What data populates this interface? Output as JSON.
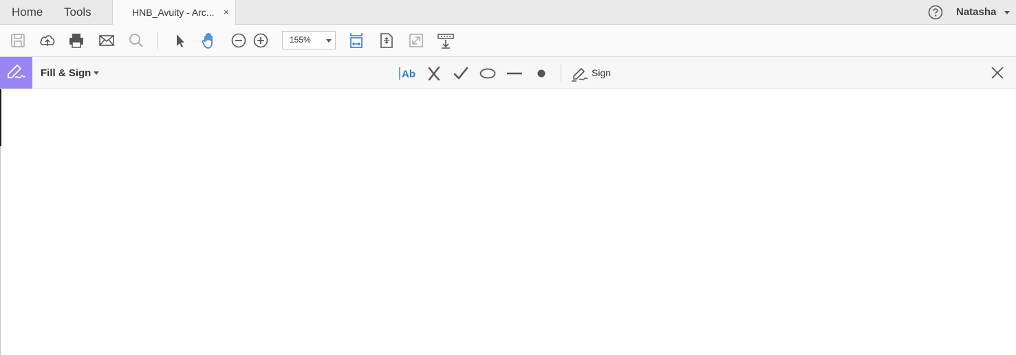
{
  "nav": {
    "home": "Home",
    "tools": "Tools"
  },
  "doc_tab": {
    "title": "HNB_Avuity - Arc...",
    "close": "×"
  },
  "user": {
    "name": "Natasha"
  },
  "toolbar": {
    "zoom": "155%"
  },
  "fill_sign": {
    "title": "Fill & Sign",
    "sign_label": "Sign"
  },
  "icons": {
    "toolbar": [
      "save-icon",
      "upload-icon",
      "print-icon",
      "email-icon",
      "search-icon",
      "select-arrow-icon",
      "hand-icon",
      "zoom-out-icon",
      "zoom-in-icon",
      "fit-width-icon",
      "fit-page-icon",
      "full-screen-icon",
      "scroll-mode-icon"
    ],
    "fill_sign": [
      "add-text-icon",
      "cross-icon",
      "checkmark-icon",
      "circle-icon",
      "line-icon",
      "dot-icon",
      "sign-pen-icon",
      "close-icon"
    ]
  },
  "colors": {
    "accent_blue": "#2b7ec8",
    "fill_sign_badge": "#9a86f3"
  }
}
